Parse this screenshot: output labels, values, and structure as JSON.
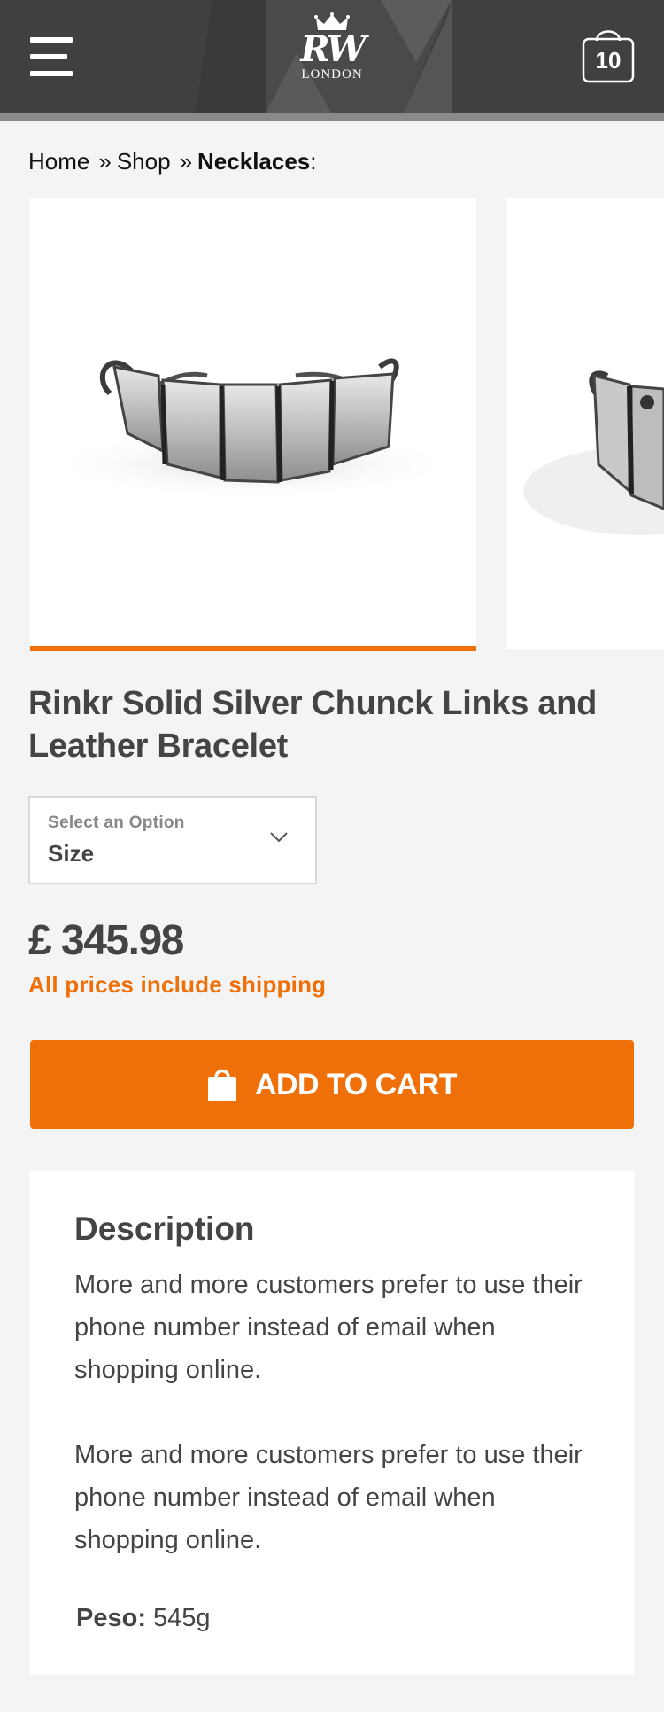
{
  "header": {
    "logo_mark": "RW",
    "logo_sub": "LONDON",
    "cart_count": "10"
  },
  "breadcrumb": {
    "home": "Home",
    "separator": "»",
    "shop": "Shop",
    "current": "Necklaces",
    "suffix": ":"
  },
  "product": {
    "title": "Rinkr Solid Silver Chunck Links and Leather Bracelet",
    "option_label": "Select an Option",
    "option_value": "Size",
    "price": "£ 345.98",
    "shipping_note": "All prices include shipping",
    "add_to_cart_label": "ADD TO CART"
  },
  "description": {
    "heading": "Description",
    "paragraphs": [
      "More and more customers prefer to use their phone number instead of email when shopping online.",
      "More and more customers prefer to use their phone number instead of email when shopping online."
    ],
    "weight_label": "Peso:",
    "weight_value": "545g"
  },
  "colors": {
    "accent": "#ef7009",
    "header_bg": "#404040",
    "page_bg": "#f4f4f4",
    "text": "#444444"
  },
  "icons": [
    "menu-icon",
    "crown-icon",
    "shopping-bag-icon",
    "chevron-down-icon",
    "bag-icon"
  ]
}
